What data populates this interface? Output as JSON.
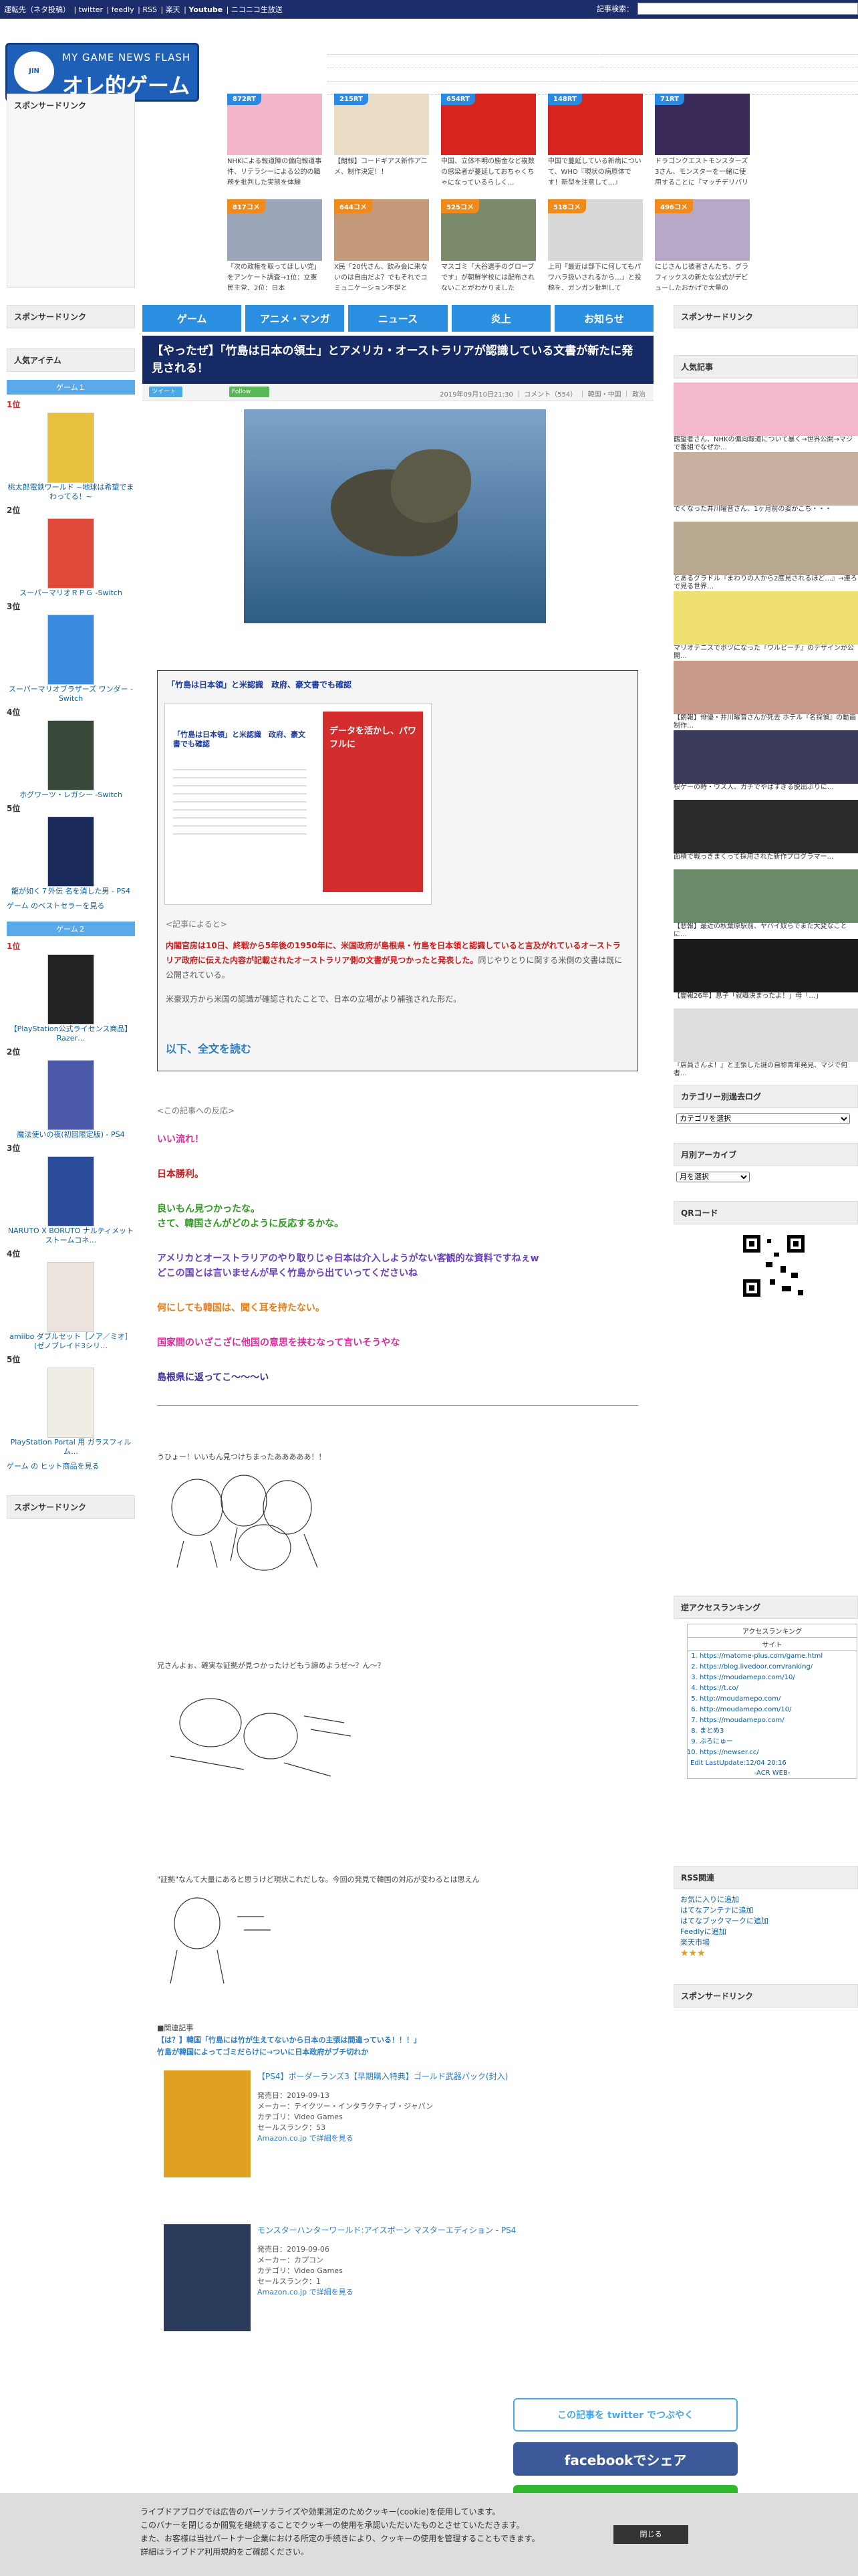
{
  "topbar": {
    "links": [
      "運転先（ネタ投稿）",
      "twitter",
      "feedly",
      "RSS",
      "楽天",
      "Youtube",
      "ニコニコ生放送"
    ],
    "search_label": "記事検索："
  },
  "logo": {
    "sub": "MY GAME NEWS FLASH",
    "main": "オレ的ゲーム速報@JIN"
  },
  "sponsor_link": "スポンサードリンク",
  "thumbs_row1": [
    {
      "tag": "872RT",
      "tag_color": "blue",
      "cap": "NHKによる報道陣の偏向報道事件、リテラシーによる公的の職務を批判した実態を体験"
    },
    {
      "tag": "215RT",
      "tag_color": "blue",
      "cap": "【朗報】コードギアス新作アニメ、制作決定！！"
    },
    {
      "tag": "654RT",
      "tag_color": "blue",
      "cap": "中国、立体不明の勝金など複数の感染者が蔓延しておちゃくちゃになっているらしく…"
    },
    {
      "tag": "148RT",
      "tag_color": "blue",
      "cap": "中国で蔓延している新病について、WHO『現状の病原体です！新型を注意して…』"
    },
    {
      "tag": "71RT",
      "tag_color": "blue",
      "cap": "ドラゴンクエストモンスターズ3さん、モンスターを一緒に使用することに『マッチデリバリー』"
    }
  ],
  "thumbs_row2": [
    {
      "tag": "817コメ",
      "tag_color": "orange",
      "cap": "「次の政権を取ってほしい党」をアンケート調査→1位：立憲民主党、2位：日本"
    },
    {
      "tag": "644コメ",
      "tag_color": "orange",
      "cap": "X民「20代さん、飲み会に来ないのは自由だよ？でもそれでコミュニケーション不足と"
    },
    {
      "tag": "525コメ",
      "tag_color": "orange",
      "cap": "マスゴミ「大谷選手のグローブです」が朝鮮学校には配布されないことがわかりました"
    },
    {
      "tag": "518コメ",
      "tag_color": "orange",
      "cap": "上司「最近は部下に何してもパワハラ扱いされるから…」と投稿を、ガンガン批判して"
    },
    {
      "tag": "496コメ",
      "tag_color": "orange",
      "cap": "にじさんじ彼者さんたち、グラフィックスの新たな公式がデビューしたおかげで大量の"
    }
  ],
  "nav": [
    "ゲーム",
    "アニメ・マンガ",
    "ニュース",
    "炎上",
    "お知らせ"
  ],
  "left": {
    "popular_title": "人気アイテム",
    "game1_tab": "ゲーム１",
    "game1": [
      {
        "rank": "1位",
        "name": "桃太郎電鉄ワールド ~地球は希望でまわってる！~"
      },
      {
        "rank": "2位",
        "name": "スーパーマリオＲＰＧ -Switch"
      },
      {
        "rank": "3位",
        "name": "スーパーマリオブラザーズ ワンダー -Switch"
      },
      {
        "rank": "4位",
        "name": "ホグワーツ・レガシー -Switch"
      },
      {
        "rank": "5位",
        "name": "龍が如く７外伝 名を消した男 - PS4"
      }
    ],
    "game1_more": "ゲーム のベストセラーを見る",
    "game2_tab": "ゲーム２",
    "game2": [
      {
        "rank": "1位",
        "name": "【PlayStation公式ライセンス商品】 Razer…"
      },
      {
        "rank": "2位",
        "name": "魔法使いの夜(初回限定版) - PS4"
      },
      {
        "rank": "3位",
        "name": "NARUTO X BORUTO ナルティメットストームコネ…"
      },
      {
        "rank": "4位",
        "name": "amiibo ダブルセット［ノア／ミオ］(ゼノブレイド3シリ…"
      },
      {
        "rank": "5位",
        "name": "PlayStation Portal 用 ガラスフィルム…"
      }
    ],
    "game2_more": "ゲーム の ヒット商品を見る",
    "sponsor_bottom": "スポンサードリンク"
  },
  "article": {
    "title": "【やったぜ】「竹島は日本の領土」とアメリカ・オーストラリアが認識している文書が新たに発見される！",
    "tweet_label": "ツイート",
    "follow_label": "Follow",
    "meta": "2019年09月10日21:30 ｜ コメント（554） ｜ 韓国・中国 ｜ 政治",
    "quote_title": "「竹島は日本領」と米認識　政府、豪文書でも確認",
    "shot_headline": "「竹島は日本領」と米認識　政府、豪文書でも確認",
    "shot_ad": "データを活かし、パワフルに",
    "quote_intro": "<記事によると>",
    "quote_red": "内閣官房は10日、終戦から5年後の1950年に、米国政府が島根県・竹島を日本領と認識していると言及がれているオーストラリア政府に伝えた内容が記載されたオーストラリア側の文書が見つかったと発表した。",
    "quote_rest": "同じやりとりに関する米側の文書は既に公開されている。",
    "quote_text2": "米豪双方から米国の認識が確認されたことで、日本の立場がより補強された形だ。",
    "read_more": "以下、全文を読む",
    "reaction_intro": "<この記事への反応>",
    "reactions": [
      {
        "text": "いい流れ！",
        "color": "#e0279b"
      },
      {
        "text": "日本勝利。",
        "color": "#d21a1a"
      },
      {
        "text": "良いもん見つかったな。\nさて、韓国さんがどのように反応するかな。",
        "color": "#2b9a1e"
      },
      {
        "text": "アメリカとオーストラリアのやり取りじゃ日本は介入しようがない客観的な資料ですねぇw\nどこの国とは言いませんが早く竹島から出ていってくださいね",
        "color": "#6b3fc4"
      },
      {
        "text": "何にしても韓国は、聞く耳を持たない。",
        "color": "#f07a12"
      },
      {
        "text": "国家間のいざこざに他国の意思を挟むなって言いそうやな",
        "color": "#e0279b"
      },
      {
        "text": "島根県に返ってこ〜〜〜い",
        "color": "#3a2e9e"
      }
    ],
    "aa1_caption": "うひょー！いいもん見つけちまったあああああ！！",
    "aa2_caption": "兄さんよぉ、確実な証拠が見つかったけどもう諦めようぜ〜？ん〜？",
    "aa3_caption": "\"証拠\"なんて大量にあると思うけど現状これだしな。今回の発見で韓国の対応が変わるとは思えん",
    "related_label": "■関連記事",
    "related1": "【は？】韓国「竹島には竹が生えてないから日本の主張は間違っている！！！」",
    "related2": "竹島が韓国によってゴミだらけに→ついに日本政府がブチ切れか",
    "products": [
      {
        "title": "【PS4】ボーダーランズ3【早期購入特典】ゴールド武器パック(封入)",
        "date": "発売日：2019-09-13",
        "maker": "メーカー：テイクツー・インタラクティブ・ジャパン",
        "category": "カテゴリ：Video Games",
        "rank": "セールスランク：53",
        "link": "Amazon.co.jp で詳細を見る"
      },
      {
        "title": "モンスターハンターワールド:アイスボーン マスターエディション - PS4",
        "date": "発売日：2019-09-06",
        "maker": "メーカー：カプコン",
        "category": "カテゴリ：Video Games",
        "rank": "セールスランク：1",
        "link": "Amazon.co.jp で詳細を見る"
      }
    ],
    "share_twitter": "この記事を twitter でつぶやく",
    "share_facebook": "facebookでシェア"
  },
  "right": {
    "sponsor_top": "スポンサードリンク",
    "popular_title": "人気記事",
    "popular": [
      "鶴望者さん、NHKの偏向報道について暴く→世界公開→マジで番組でなぜか…",
      "でくなった井川曜音さん、1ヶ月前の姿がこち・・・",
      "とあるグラドル『まわりの人から2度見されるほど…』→連ろで見る世界…",
      "マリオテニスでポツになった『ワルピーチ』のデザインが公開…",
      "【朗報】俳優・井川曜音さんが死去 ホテル『名探偵』の動画制作…",
      "桜ゲーの時・ウス人、ガチでやばすぎる脱出ぶりに…",
      "面積で戦っきまくって採用された新作プログラマー…",
      "【悲報】最近の秋葉原駅前、ヤバイ奴らでまた大変なことに…",
      "【闇報26年】息子「就職決まったよ！」母「…」",
      "『店員さんよ！』と主張した謎の自称青年発見、マジで何者…"
    ],
    "category_title": "カテゴリー別過去ログ",
    "category_select": "カテゴリを選択",
    "archive_title": "月別アーカイブ",
    "archive_select": "月を選択",
    "qr_title": "QRコード",
    "ranking_title": "逆アクセスランキング",
    "ranking_header": "アクセスランキング",
    "ranking_sub": "サイト",
    "ranking": [
      "https://matome-plus.com/game.html",
      "https://blog.livedoor.com/ranking/",
      "https://moudamepo.com/10/",
      "https://t.co/",
      "http://moudamepo.com/",
      "http://moudamepo.com/10/",
      "https://moudamepo.com/",
      "まとめ3",
      "ぶろにゅー",
      "https://newser.cc/"
    ],
    "ranking_update": "Edit LastUpdate:12/04 20:16",
    "ranking_footer": "-ACR WEB-",
    "rss_title": "RSS関連",
    "rss_links": [
      "お気に入りに追加",
      "はてなアンテナに追加",
      "はてなブックマークに追加",
      "Feedlyに追加",
      "楽天市場"
    ],
    "sponsor_bottom": "スポンサードリンク"
  },
  "cookie": {
    "lines": [
      "ライブドアブログでは広告のパーソナライズや効果測定のためクッキー(cookie)を使用しています。",
      "このバナーを閉じるか閲覧を継続することでクッキーの使用を承認いただいたものとさせていただきます。",
      "また、お客様は当社パートナー企業における所定の手続きにより、クッキーの使用を管理することもできます。",
      "詳細はライブドア利用規約をご確認ください。"
    ],
    "close": "閉じる"
  }
}
